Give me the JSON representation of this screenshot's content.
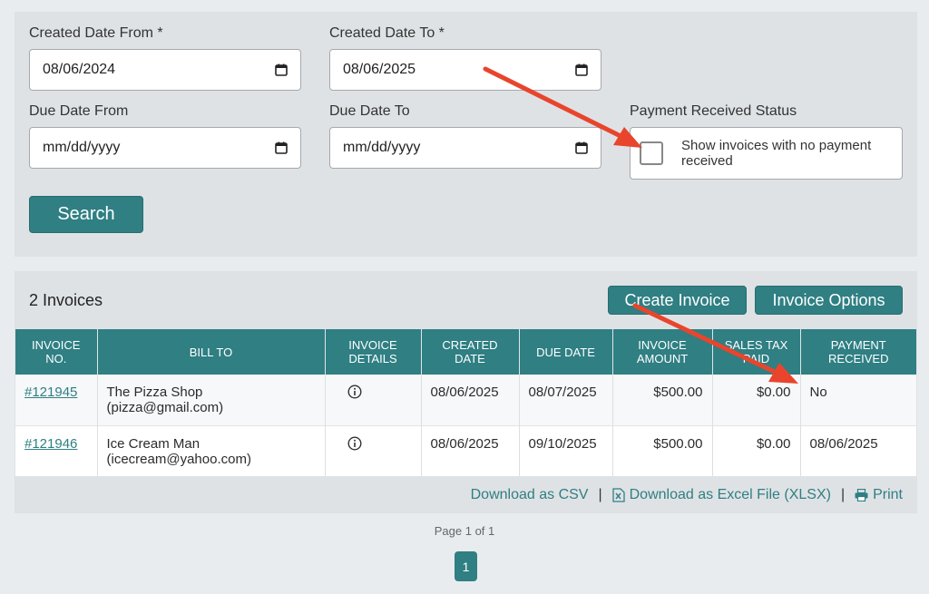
{
  "filters": {
    "created_from": {
      "label": "Created Date From *",
      "value": "08/06/2024"
    },
    "created_to": {
      "label": "Created Date To *",
      "value": "08/06/2025"
    },
    "due_from": {
      "label": "Due Date From",
      "placeholder": "mm/dd/yyyy"
    },
    "due_to": {
      "label": "Due Date To",
      "placeholder": "mm/dd/yyyy"
    },
    "payment_status": {
      "label": "Payment Received Status",
      "checkbox_text": "Show invoices with no payment received",
      "checked": false
    },
    "search_label": "Search"
  },
  "results": {
    "count_label": "2 Invoices",
    "create_label": "Create Invoice",
    "options_label": "Invoice Options",
    "columns": [
      "INVOICE NO.",
      "BILL TO",
      "INVOICE DETAILS",
      "CREATED DATE",
      "DUE DATE",
      "INVOICE AMOUNT",
      "SALES TAX PAID",
      "PAYMENT RECEIVED"
    ],
    "rows": [
      {
        "invoice_no": "#121945",
        "bill_to_name": "The Pizza Shop",
        "bill_to_email": "(pizza@gmail.com)",
        "created": "08/06/2025",
        "due": "08/07/2025",
        "amount": "$500.00",
        "tax": "$0.00",
        "payment": "No"
      },
      {
        "invoice_no": "#121946",
        "bill_to_name": "Ice Cream Man",
        "bill_to_email": "(icecream@yahoo.com)",
        "created": "08/06/2025",
        "due": "09/10/2025",
        "amount": "$500.00",
        "tax": "$0.00",
        "payment": "08/06/2025"
      }
    ],
    "download_csv": "Download as CSV",
    "download_xlsx": "Download as Excel File (XLSX)",
    "print": "Print",
    "separator": "|"
  },
  "pagination": {
    "text": "Page 1 of 1",
    "current": "1"
  },
  "colors": {
    "accent": "#2f7f83",
    "annotation": "#e8452c"
  },
  "icons": [
    "calendar-icon",
    "info-icon",
    "excel-icon",
    "print-icon"
  ]
}
